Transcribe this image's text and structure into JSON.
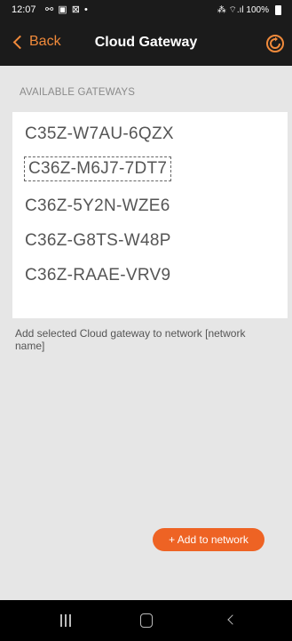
{
  "status_bar": {
    "time": "12:07",
    "notifications": "⚯ ▣ ⊠ •",
    "system": "⁂ ⌔.ıl 100%"
  },
  "nav": {
    "back_label": "Back",
    "title": "Cloud Gateway"
  },
  "section": {
    "header": "AVAILABLE GATEWAYS"
  },
  "gateways": [
    {
      "id": "C35Z-W7AU-6QZX",
      "selected": false
    },
    {
      "id": "C36Z-M6J7-7DT7",
      "selected": true
    },
    {
      "id": "C36Z-5Y2N-WZE6",
      "selected": false
    },
    {
      "id": "C36Z-G8TS-W48P",
      "selected": false
    },
    {
      "id": "C36Z-RAAE-VRV9",
      "selected": false
    }
  ],
  "hint": "Add selected Cloud gateway to network [network name]",
  "actions": {
    "add_label": "+ Add to network"
  },
  "colors": {
    "accent": "#f08a3b",
    "button": "#ee6324",
    "background": "#e6e6e6",
    "nav_bar": "#1b1b1b"
  }
}
